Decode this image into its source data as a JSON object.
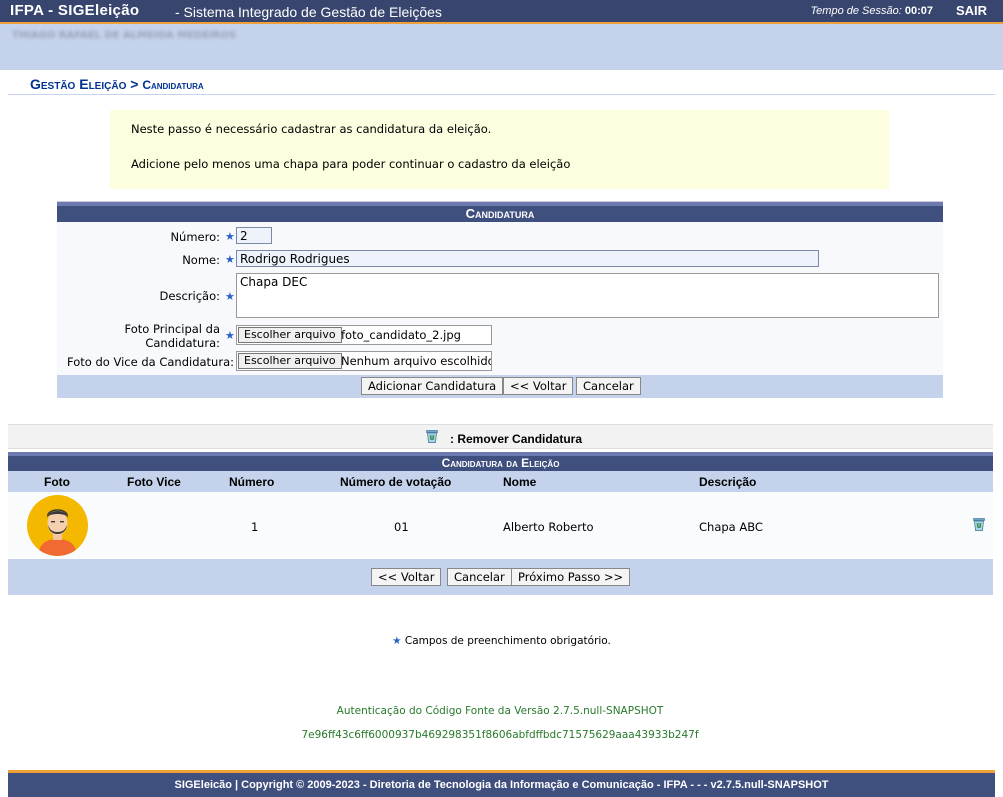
{
  "header": {
    "system_name": "IFPA - SIGEleição",
    "system_desc": "- Sistema Integrado de Gestão de Eleições",
    "session_label": "Tempo de Sessão:",
    "session_time": "00:07",
    "logout": "SAIR",
    "user_name": "THIAGO RAFAEL DE ALMEIDA MEDEIROS"
  },
  "page": {
    "title_main": "Gestão Eleição >",
    "title_sub": "Candidatura"
  },
  "info": {
    "line1": "Neste passo é necessário cadastrar as candidatura da eleição.",
    "line2": "Adicione pelo menos uma chapa para poder continuar o cadastro da eleição"
  },
  "form": {
    "title": "Candidatura",
    "numero_label": "Número:",
    "numero_value": "2",
    "nome_label": "Nome:",
    "nome_value": "Rodrigo Rodrigues",
    "descricao_label": "Descrição:",
    "descricao_value": "Chapa DEC",
    "foto_label_1": "Foto Principal da",
    "foto_label_2": "Candidatura:",
    "foto_button": "Escolher arquivo",
    "foto_file": "foto_candidato_2.jpg",
    "vice_label": "Foto do Vice da Candidatura:",
    "vice_button": "Escolher arquivo",
    "vice_file": "Nenhum arquivo escolhido",
    "btn_add": "Adicionar Candidatura",
    "btn_back": "<< Voltar",
    "btn_cancel": "Cancelar"
  },
  "legend": {
    "remove_text": ": Remover Candidatura"
  },
  "list": {
    "title": "Candidatura da Eleição",
    "columns": [
      "Foto",
      "Foto Vice",
      "Número",
      "Número de votação",
      "Nome",
      "Descrição"
    ],
    "rows": [
      {
        "numero": "1",
        "votacao": "01",
        "nome": "Alberto Roberto",
        "descricao": "Chapa ABC"
      }
    ],
    "btn_back": "<< Voltar",
    "btn_cancel": "Cancelar",
    "btn_next": "Próximo Passo >>"
  },
  "footer": {
    "required_note": "Campos de preenchimento obrigatório.",
    "auth_line1": "Autenticação do Código Fonte da Versão 2.7.5.null-SNAPSHOT",
    "auth_line2": "7e96ff43c6ff6000937b469298351f8606abfdffbdc71575629aaa43933b247f",
    "copyright": "SIGEleicão | Copyright © 2009-2023 - Diretoria de Tecnologia da Informação e Comunicação - IFPA - - - v2.7.5.null-SNAPSHOT"
  },
  "colors": {
    "header_bg": "#38466f",
    "accent_orange": "#f0a038",
    "light_blue": "#c4d2eb",
    "title_blue": "#003390",
    "required_star": "#2a62c4",
    "avatar_yellow": "#f5b800",
    "auth_green": "#277a2a"
  },
  "icons": {
    "trash": "trash-icon",
    "star": "required-star-icon",
    "avatar": "avatar-icon"
  }
}
